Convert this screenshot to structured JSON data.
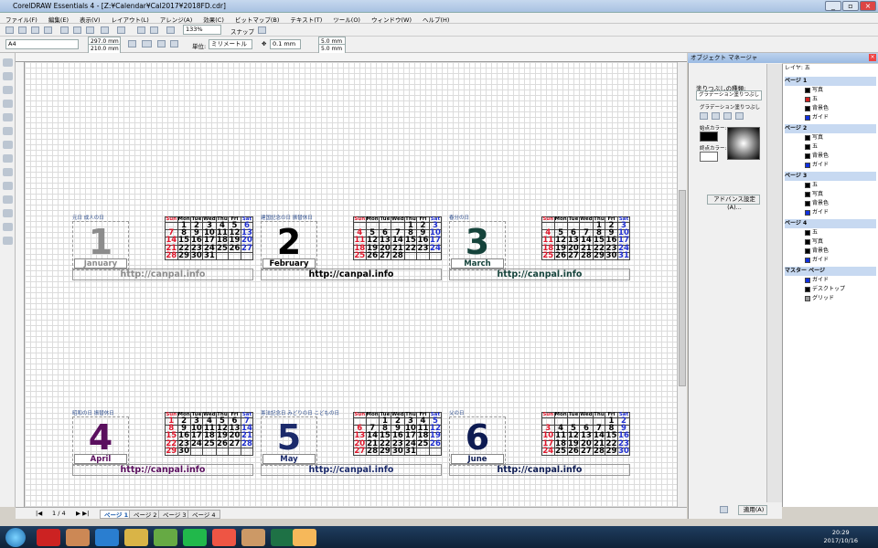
{
  "window": {
    "title": "CorelDRAW Essentials 4 - [Z:¥Calendar¥Cal2017¥2018FD.cdr]"
  },
  "menu": [
    "ファイル(F)",
    "編集(E)",
    "表示(V)",
    "レイアウト(L)",
    "アレンジ(A)",
    "効果(C)",
    "ビットマップ(B)",
    "テキスト(T)",
    "ツール(O)",
    "ウィンドウ(W)",
    "ヘルプ(H)"
  ],
  "toolbar": {
    "zoom": "133%",
    "snap": "スナップ",
    "paper": "A4",
    "width": "297.0 mm",
    "height": "210.0 mm",
    "units_label": "単位:",
    "units": "ミリメートル",
    "nudge": "0.1 mm",
    "dup_x": "5.0 mm",
    "dup_y": "5.0 mm"
  },
  "canvas": {
    "url_text": "http://canpal.info"
  },
  "calendars": [
    {
      "num": "1",
      "name": "January",
      "color": "#8c8c8c",
      "sub": "元日 成人の日",
      "days": [
        [
          "",
          "1",
          "2",
          "3",
          "4",
          "5",
          "6"
        ],
        [
          "7",
          "8",
          "9",
          "10",
          "11",
          "12",
          "13"
        ],
        [
          "14",
          "15",
          "16",
          "17",
          "18",
          "19",
          "20"
        ],
        [
          "21",
          "22",
          "23",
          "24",
          "25",
          "26",
          "27"
        ],
        [
          "28",
          "29",
          "30",
          "31",
          "",
          "",
          ""
        ]
      ]
    },
    {
      "num": "2",
      "name": "February",
      "color": "#000000",
      "sub": "建国記念の日 振替休日",
      "days": [
        [
          "",
          "",
          "",
          "",
          "1",
          "2",
          "3"
        ],
        [
          "4",
          "5",
          "6",
          "7",
          "8",
          "9",
          "10"
        ],
        [
          "11",
          "12",
          "13",
          "14",
          "15",
          "16",
          "17"
        ],
        [
          "18",
          "19",
          "20",
          "21",
          "22",
          "23",
          "24"
        ],
        [
          "25",
          "26",
          "27",
          "28",
          "",
          "",
          ""
        ]
      ]
    },
    {
      "num": "3",
      "name": "March",
      "color": "#15433b",
      "sub": "春分の日",
      "days": [
        [
          "",
          "",
          "",
          "",
          "1",
          "2",
          "3"
        ],
        [
          "4",
          "5",
          "6",
          "7",
          "8",
          "9",
          "10"
        ],
        [
          "11",
          "12",
          "13",
          "14",
          "15",
          "16",
          "17"
        ],
        [
          "18",
          "19",
          "20",
          "21",
          "22",
          "23",
          "24"
        ],
        [
          "25",
          "26",
          "27",
          "28",
          "29",
          "30",
          "31"
        ]
      ]
    },
    {
      "num": "4",
      "name": "April",
      "color": "#5a0f5e",
      "sub": "昭和の日 振替休日",
      "days": [
        [
          "1",
          "2",
          "3",
          "4",
          "5",
          "6",
          "7"
        ],
        [
          "8",
          "9",
          "10",
          "11",
          "12",
          "13",
          "14"
        ],
        [
          "15",
          "16",
          "17",
          "18",
          "19",
          "20",
          "21"
        ],
        [
          "22",
          "23",
          "24",
          "25",
          "26",
          "27",
          "28"
        ],
        [
          "29",
          "30",
          "",
          "",
          "",
          "",
          ""
        ]
      ]
    },
    {
      "num": "5",
      "name": "May",
      "color": "#1b2a6b",
      "sub": "憲法記念日 みどりの日 こどもの日",
      "days": [
        [
          "",
          "",
          "1",
          "2",
          "3",
          "4",
          "5"
        ],
        [
          "6",
          "7",
          "8",
          "9",
          "10",
          "11",
          "12"
        ],
        [
          "13",
          "14",
          "15",
          "16",
          "17",
          "18",
          "19"
        ],
        [
          "20",
          "21",
          "22",
          "23",
          "24",
          "25",
          "26"
        ],
        [
          "27",
          "28",
          "29",
          "30",
          "31",
          "",
          ""
        ]
      ]
    },
    {
      "num": "6",
      "name": "June",
      "color": "#0d1b52",
      "sub": "父の日",
      "days": [
        [
          "",
          "",
          "",
          "",
          "",
          "1",
          "2"
        ],
        [
          "3",
          "4",
          "5",
          "6",
          "7",
          "8",
          "9"
        ],
        [
          "10",
          "11",
          "12",
          "13",
          "14",
          "15",
          "16"
        ],
        [
          "17",
          "18",
          "19",
          "20",
          "21",
          "22",
          "23"
        ],
        [
          "24",
          "25",
          "26",
          "27",
          "28",
          "29",
          "30"
        ]
      ]
    }
  ],
  "weekdays": [
    "Sun",
    "Mon",
    "Tue",
    "Wed",
    "Thu",
    "Fri",
    "Sat"
  ],
  "status": {
    "pageinfo": "1 / 4",
    "tabs": [
      "ページ 1",
      "ページ 2",
      "ページ 3",
      "ページ 4"
    ]
  },
  "docker": {
    "title": "オブジェクト マネージャ",
    "fill_type_label": "塗りつぶしの種類:",
    "fill_type": "グラデーション塗りつぶし",
    "gradient_label": "グラデーション塗りつぶし",
    "start_color_label": "始点カラー:",
    "end_color_label": "終点カラー:",
    "advanced_button": "アドバンス設定(A)...",
    "apply_button": "適用(A)"
  },
  "objmgr": {
    "header": "レイヤ: 五",
    "pages": [
      {
        "label": "ページ 1",
        "layers": [
          {
            "name": "写真",
            "color": "#000000"
          },
          {
            "name": "五",
            "color": "#d02020"
          },
          {
            "name": "背景色",
            "color": "#000000"
          },
          {
            "name": "ガイド",
            "color": "#1030e0"
          }
        ]
      },
      {
        "label": "ページ 2",
        "layers": [
          {
            "name": "写真",
            "color": "#000000"
          },
          {
            "name": "五",
            "color": "#000000"
          },
          {
            "name": "背景色",
            "color": "#000000"
          },
          {
            "name": "ガイド",
            "color": "#1030e0"
          }
        ]
      },
      {
        "label": "ページ 3",
        "layers": [
          {
            "name": "五",
            "color": "#000000"
          },
          {
            "name": "写真",
            "color": "#000000"
          },
          {
            "name": "背景色",
            "color": "#000000"
          },
          {
            "name": "ガイド",
            "color": "#1030e0"
          }
        ]
      },
      {
        "label": "ページ 4",
        "layers": [
          {
            "name": "五",
            "color": "#000000"
          },
          {
            "name": "写真",
            "color": "#000000"
          },
          {
            "name": "背景色",
            "color": "#000000"
          },
          {
            "name": "ガイド",
            "color": "#1030e0"
          }
        ]
      },
      {
        "label": "マスター ページ",
        "layers": [
          {
            "name": "ガイド",
            "color": "#1030e0"
          },
          {
            "name": "デスクトップ",
            "color": "#000000"
          },
          {
            "name": "グリッド",
            "color": "#999999"
          }
        ]
      }
    ]
  },
  "taskbar": {
    "time": "20:29",
    "date": "2017/10/16"
  }
}
